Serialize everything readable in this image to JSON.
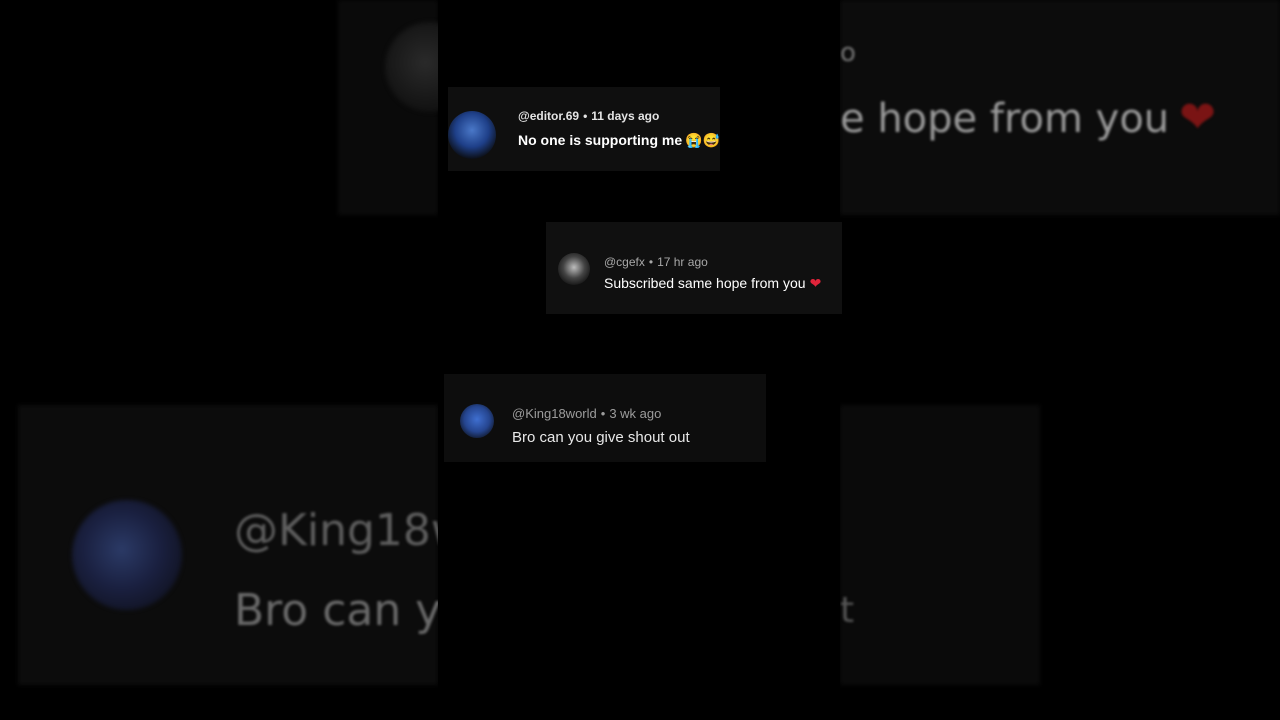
{
  "background": {
    "echo_top_fragment": "o",
    "echo_top_text": "e hope from you",
    "echo_heart": "❤",
    "echo_bottom_handle": "@King18w",
    "echo_bottom_text": "Bro can y",
    "echo_bottom_right": "t"
  },
  "comments": [
    {
      "handle": "@editor.69",
      "separator": "•",
      "time": "11 days ago",
      "text": "No one is supporting me",
      "emoji": "😭😅",
      "avatar_icon": "blue-player-avatar-icon"
    },
    {
      "handle": "@cgefx",
      "separator": "•",
      "time": "17 hr ago",
      "text": "Subscribed same hope from you",
      "emoji": "❤",
      "avatar_icon": "dark-logo-avatar-icon"
    },
    {
      "handle": "@King18world",
      "separator": "•",
      "time": "3 wk ago",
      "text": "Bro can you give shout out",
      "avatar_icon": "blue-jersey-avatar-icon"
    }
  ],
  "colors": {
    "background": "#000000",
    "card": "#0f0f0f",
    "heart": "#e0243a"
  }
}
